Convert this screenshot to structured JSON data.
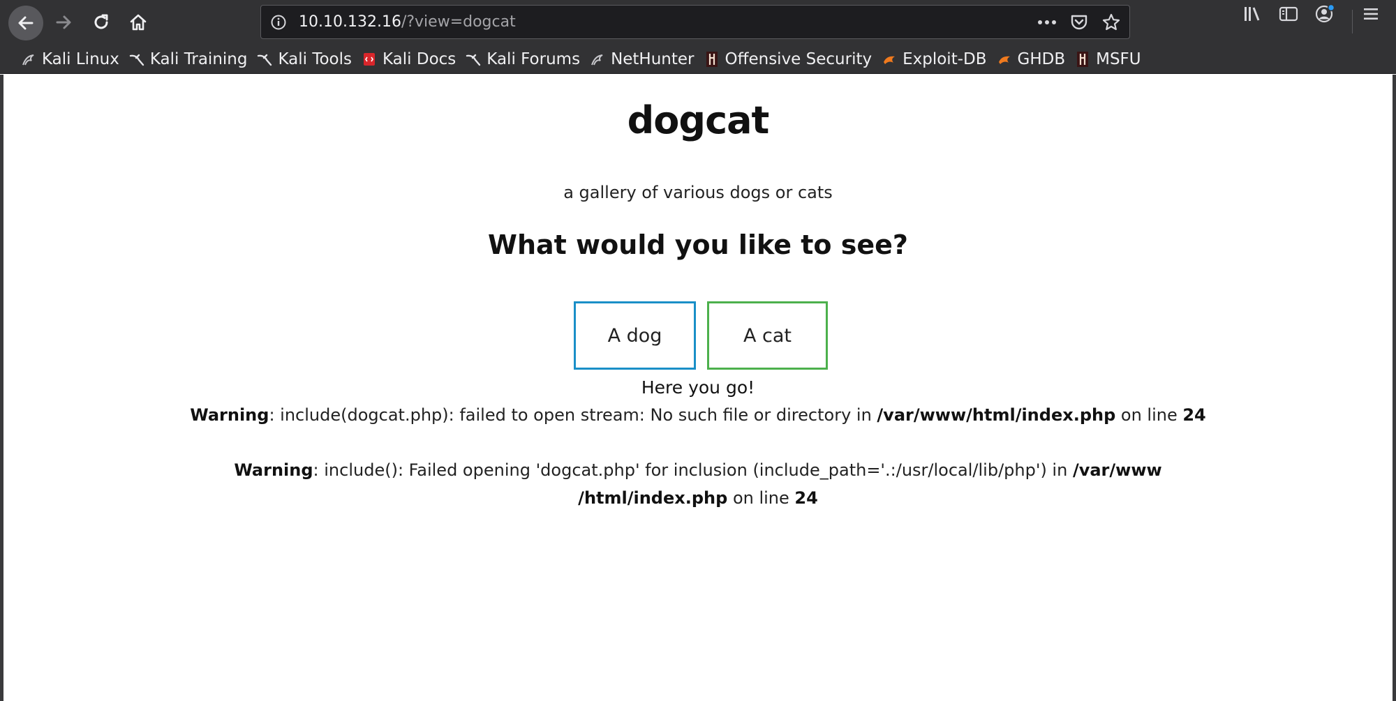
{
  "browser": {
    "url_host": "10.10.132.16",
    "url_path": "/?view=dogcat",
    "icons": {
      "back": "back-arrow-icon",
      "forward": "forward-arrow-icon",
      "reload": "reload-icon",
      "home": "home-icon",
      "info": "info-icon",
      "more": "more-dots-icon",
      "pocket": "pocket-icon",
      "bookmark_star": "star-icon",
      "library": "library-icon",
      "sidebar": "sidebar-icon",
      "account": "account-icon",
      "menu": "hamburger-menu-icon"
    },
    "bookmarks": [
      {
        "label": "Kali Linux",
        "icon": "kali-dragon-icon"
      },
      {
        "label": "Kali Training",
        "icon": "kali-dragon-icon"
      },
      {
        "label": "Kali Tools",
        "icon": "kali-dragon-icon"
      },
      {
        "label": "Kali Docs",
        "icon": "kali-docs-icon"
      },
      {
        "label": "Kali Forums",
        "icon": "kali-dragon-icon"
      },
      {
        "label": "NetHunter",
        "icon": "kali-dragon-icon"
      },
      {
        "label": "Offensive Security",
        "icon": "offsec-icon"
      },
      {
        "label": "Exploit-DB",
        "icon": "exploitdb-icon"
      },
      {
        "label": "GHDB",
        "icon": "exploitdb-icon"
      },
      {
        "label": "MSFU",
        "icon": "offsec-icon"
      }
    ]
  },
  "page": {
    "title": "dogcat",
    "subtitle": "a gallery of various dogs or cats",
    "question": "What would you like to see?",
    "dog_button": "A dog",
    "cat_button": "A cat",
    "result": "Here you go!",
    "warning1": {
      "label": "Warning",
      "message": ": include(dogcat.php): failed to open stream: No such file or directory in ",
      "path": "/var/www/html/index.php",
      "on_line": " on line ",
      "line": "24"
    },
    "warning2": {
      "label": "Warning",
      "message": ": include(): Failed opening 'dogcat.php' for inclusion (include_path='.:/usr/local/lib/php') in ",
      "path_part1": "/var/www",
      "path_part2": "/html/index.php",
      "on_line": " on line ",
      "line": "24"
    }
  },
  "colors": {
    "chrome_bg": "#323234",
    "url_bg": "#1d1d20",
    "dog_border": "#1a8fc7",
    "cat_border": "#4cb04c"
  }
}
